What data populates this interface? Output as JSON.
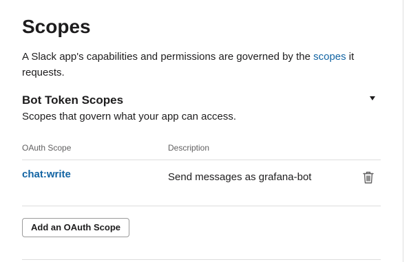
{
  "page": {
    "title": "Scopes",
    "intro_before": "A Slack app's capabilities and permissions are governed by the ",
    "intro_link": "scopes",
    "intro_after": " it requests."
  },
  "bot_token_scopes": {
    "title": "Bot Token Scopes",
    "subtitle": "Scopes that govern what your app can access.",
    "columns": {
      "scope": "OAuth Scope",
      "description": "Description"
    },
    "rows": [
      {
        "scope": "chat:write",
        "description": "Send messages as grafana-bot"
      }
    ],
    "add_button_label": "Add an OAuth Scope",
    "collapse_icon": "caret-down-icon",
    "delete_icon": "trash-icon"
  },
  "colors": {
    "link": "#1264a3",
    "text": "#1d1c1d",
    "muted": "#616061",
    "divider": "#dddddd"
  }
}
